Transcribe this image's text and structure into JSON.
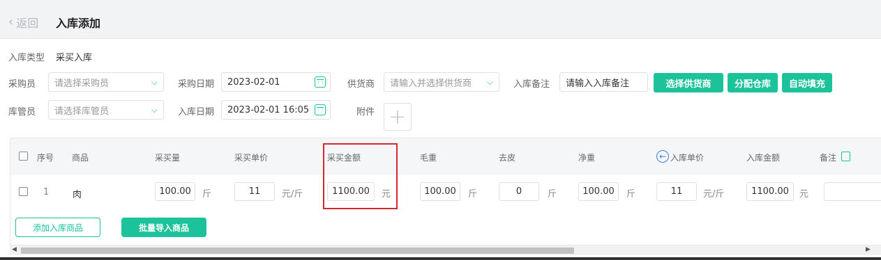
{
  "header": {
    "back_label": "返回",
    "title": "入库添加"
  },
  "form": {
    "type_label": "入库类型",
    "type_value": "采买入库",
    "buyer_label": "采购员",
    "buyer_placeholder": "请选择采购员",
    "purchase_date_label": "采购日期",
    "purchase_date_value": "2023-02-01",
    "supplier_label": "供货商",
    "supplier_placeholder": "请输入并选择供货商",
    "remark_label": "入库备注",
    "remark_placeholder": "请输入入库备注",
    "keeper_label": "库管员",
    "keeper_placeholder": "请选择库管员",
    "stockin_date_label": "入库日期",
    "stockin_date_value": "2023-02-01 16:05",
    "attachment_label": "附件"
  },
  "actions": {
    "select_supplier": "选择供货商",
    "assign_warehouse": "分配仓库",
    "auto_fill": "自动填充"
  },
  "table": {
    "headers": {
      "index": "序号",
      "product": "商品",
      "qty": "采买量",
      "unit_price": "采买单价",
      "amount": "采买金额",
      "gross": "毛重",
      "tare": "去皮",
      "net": "净重",
      "in_price": "入库单价",
      "in_amount": "入库金额",
      "remark": "备注"
    },
    "row": {
      "index": "1",
      "product": "肉",
      "qty": "100.00",
      "qty_unit": "斤",
      "unit_price": "11",
      "unit_price_unit": "元/斤",
      "amount": "1100.00",
      "amount_unit": "元",
      "gross": "100.00",
      "gross_unit": "斤",
      "tare": "0",
      "tare_unit": "斤",
      "net": "100.00",
      "net_unit": "斤",
      "in_price": "11",
      "in_price_unit": "元/斤",
      "in_amount": "1100.00",
      "in_amount_unit": "元",
      "remark": ""
    }
  },
  "footer_buttons": {
    "add_item": "添加入库商品",
    "batch_import": "批量导入商品"
  },
  "colors": {
    "accent": "#1cc29a",
    "highlight": "#d9262c"
  }
}
